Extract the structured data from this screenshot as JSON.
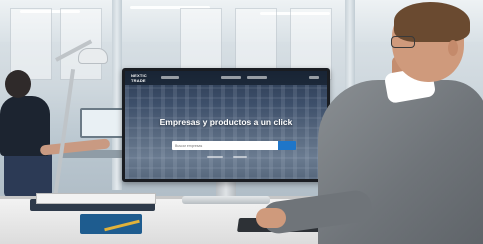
{
  "monitor": {
    "logo_line1": "NEXTIC",
    "logo_line2": "TRADE",
    "hero_title": "Empresas y productos a un click",
    "search_placeholder": "Buscar empresas"
  }
}
